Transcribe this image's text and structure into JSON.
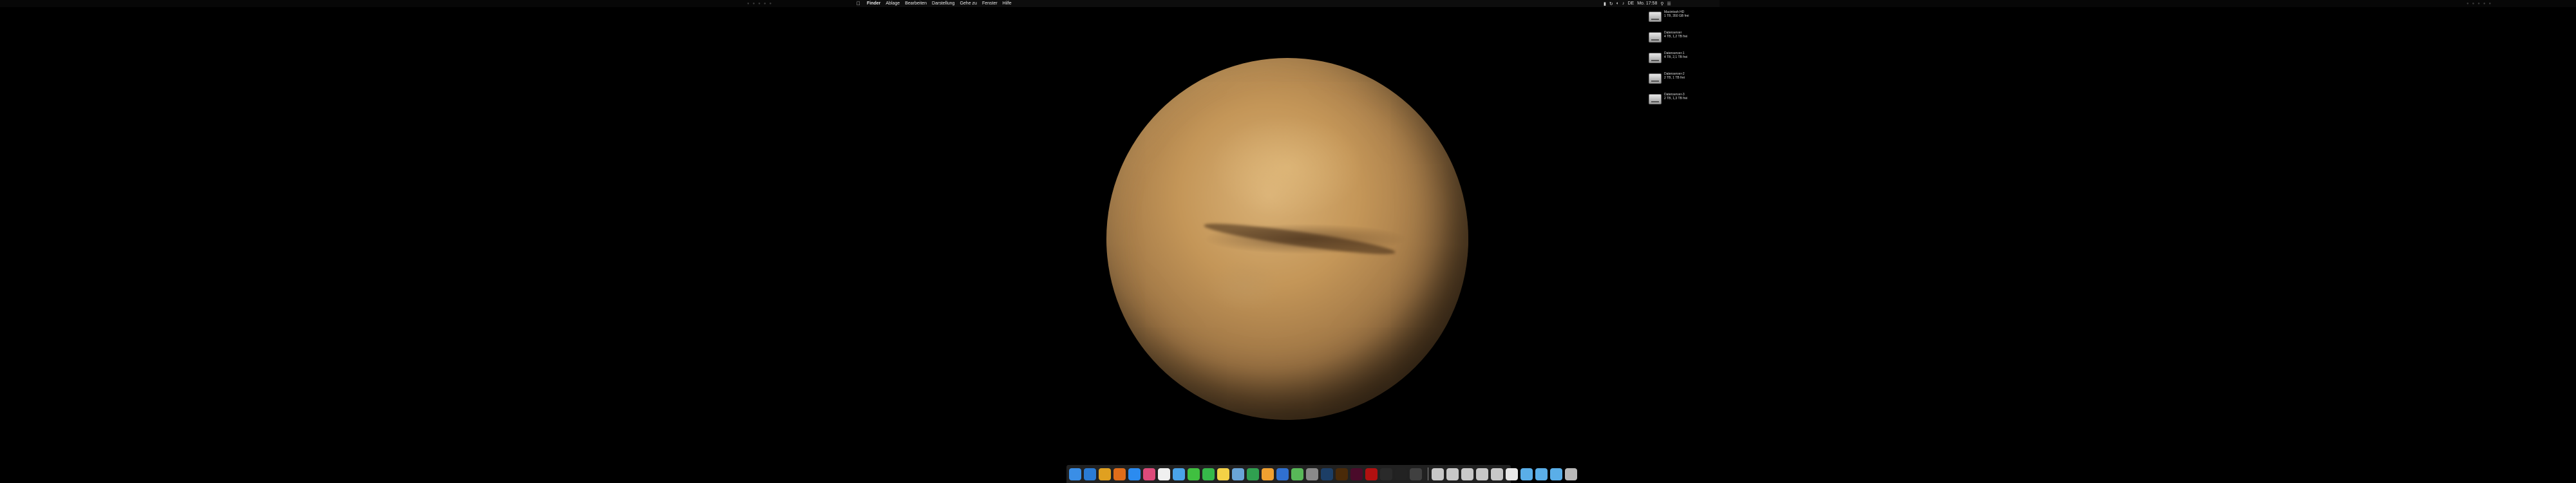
{
  "menubar": {
    "apple_symbol": "",
    "items": [
      "Finder",
      "Ablage",
      "Bearbeiten",
      "Darstellung",
      "Gehe zu",
      "Fenster",
      "Hilfe"
    ]
  },
  "status": {
    "language": "DE",
    "datetime": "Mo. 17:58"
  },
  "drives": [
    {
      "name": "Macintosh HD",
      "info": "1 TB, 350 GB frei"
    },
    {
      "name": "Datenserver",
      "info": "4 TB, 1,2 TB frei"
    },
    {
      "name": "Datenserver-1",
      "info": "4 TB, 2,1 TB frei"
    },
    {
      "name": "Datenserver-2",
      "info": "2 TB, 1 TB frei"
    },
    {
      "name": "Datenserver-3",
      "info": "2 TB, 1,3 TB frei"
    }
  ],
  "dock": {
    "apps": [
      {
        "name": "finder-icon",
        "color": "#3a8ee6"
      },
      {
        "name": "safari-icon",
        "color": "#2a7bd4"
      },
      {
        "name": "chrome-icon",
        "color": "#e0a020"
      },
      {
        "name": "firefox-icon",
        "color": "#e06d1a"
      },
      {
        "name": "appstore-icon",
        "color": "#2b8bf0"
      },
      {
        "name": "photos-icon",
        "color": "#dd4a7a"
      },
      {
        "name": "calendar-icon",
        "color": "#f0f0f0"
      },
      {
        "name": "mail-icon",
        "color": "#4aa3e8"
      },
      {
        "name": "messages-icon",
        "color": "#40c040"
      },
      {
        "name": "facetime-icon",
        "color": "#36b84a"
      },
      {
        "name": "notes-icon",
        "color": "#f3d246"
      },
      {
        "name": "preview-icon",
        "color": "#6aa5d8"
      },
      {
        "name": "numbers-icon",
        "color": "#30a050"
      },
      {
        "name": "pages-icon",
        "color": "#f0a030"
      },
      {
        "name": "keynote-icon",
        "color": "#3070d0"
      },
      {
        "name": "maps-icon",
        "color": "#58b858"
      },
      {
        "name": "system-preferences-icon",
        "color": "#8a8a8a"
      },
      {
        "name": "photoshop-icon",
        "color": "#1c3e66"
      },
      {
        "name": "illustrator-icon",
        "color": "#4a2a08"
      },
      {
        "name": "indesign-icon",
        "color": "#4a0a2a"
      },
      {
        "name": "acrobat-icon",
        "color": "#b01010"
      },
      {
        "name": "bridge-icon",
        "color": "#2a2a2a"
      },
      {
        "name": "terminal-icon",
        "color": "#222222"
      },
      {
        "name": "activity-monitor-icon",
        "color": "#404040"
      }
    ],
    "folders": [
      {
        "name": "drive-icon-1",
        "color": "#c8c8c8"
      },
      {
        "name": "drive-icon-2",
        "color": "#c8c8c8"
      },
      {
        "name": "drive-icon-3",
        "color": "#c8c8c8"
      },
      {
        "name": "drive-icon-4",
        "color": "#c8c8c8"
      },
      {
        "name": "drive-icon-5",
        "color": "#c8c8c8"
      },
      {
        "name": "document-icon",
        "color": "#e8e8e8"
      },
      {
        "name": "downloads-folder-icon",
        "color": "#5aaee8"
      },
      {
        "name": "documents-folder-icon",
        "color": "#5aaee8"
      },
      {
        "name": "applications-folder-icon",
        "color": "#5aaee8"
      },
      {
        "name": "trash-icon",
        "color": "#b8b8b8"
      }
    ]
  }
}
